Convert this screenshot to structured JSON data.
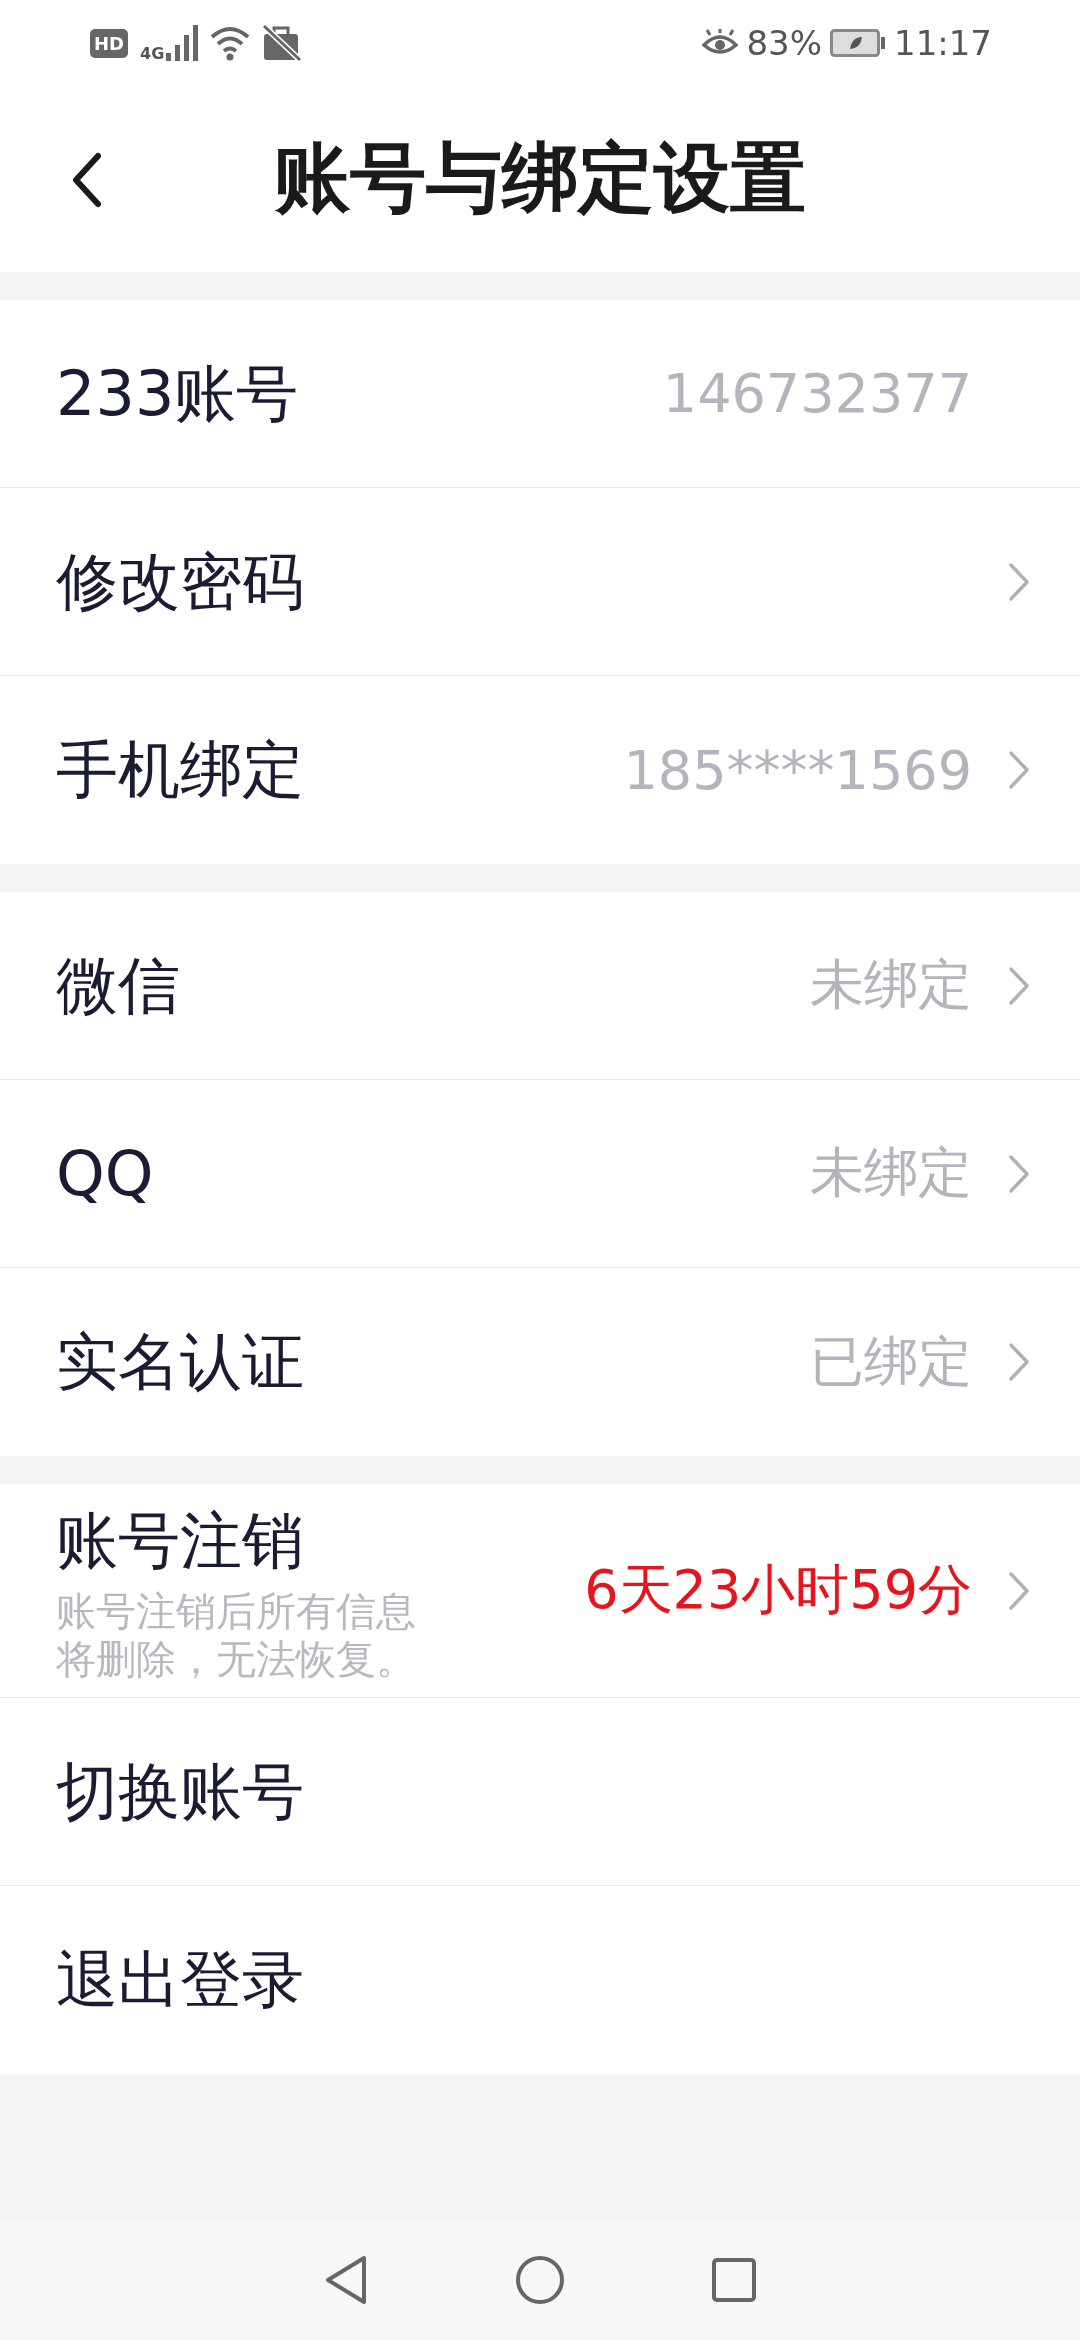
{
  "status_bar": {
    "hd": "HD",
    "network": "4G",
    "battery_percent": "83%",
    "time": "11:17"
  },
  "header": {
    "title": "账号与绑定设置"
  },
  "groups": [
    {
      "rows": [
        {
          "label": "233账号",
          "value": "146732377",
          "chevron": false,
          "warning": false
        },
        {
          "label": "修改密码",
          "chevron": true
        },
        {
          "label": "手机绑定",
          "value": "185****1569",
          "chevron": true,
          "warning": false
        }
      ]
    },
    {
      "rows": [
        {
          "label": "微信",
          "value": "未绑定",
          "chevron": true,
          "warning": false
        },
        {
          "label": "QQ",
          "value": "未绑定",
          "chevron": true,
          "warning": false
        },
        {
          "label": "实名认证",
          "value": "已绑定",
          "chevron": true,
          "warning": false
        }
      ]
    },
    {
      "rows": [
        {
          "label": "账号注销",
          "note": "账号注销后所有信息将删除，无法恢复。",
          "value": "6天23小时59分",
          "chevron": true,
          "warning": true
        },
        {
          "label": "切换账号",
          "chevron": false
        },
        {
          "label": "退出登录",
          "chevron": false
        }
      ]
    }
  ]
}
